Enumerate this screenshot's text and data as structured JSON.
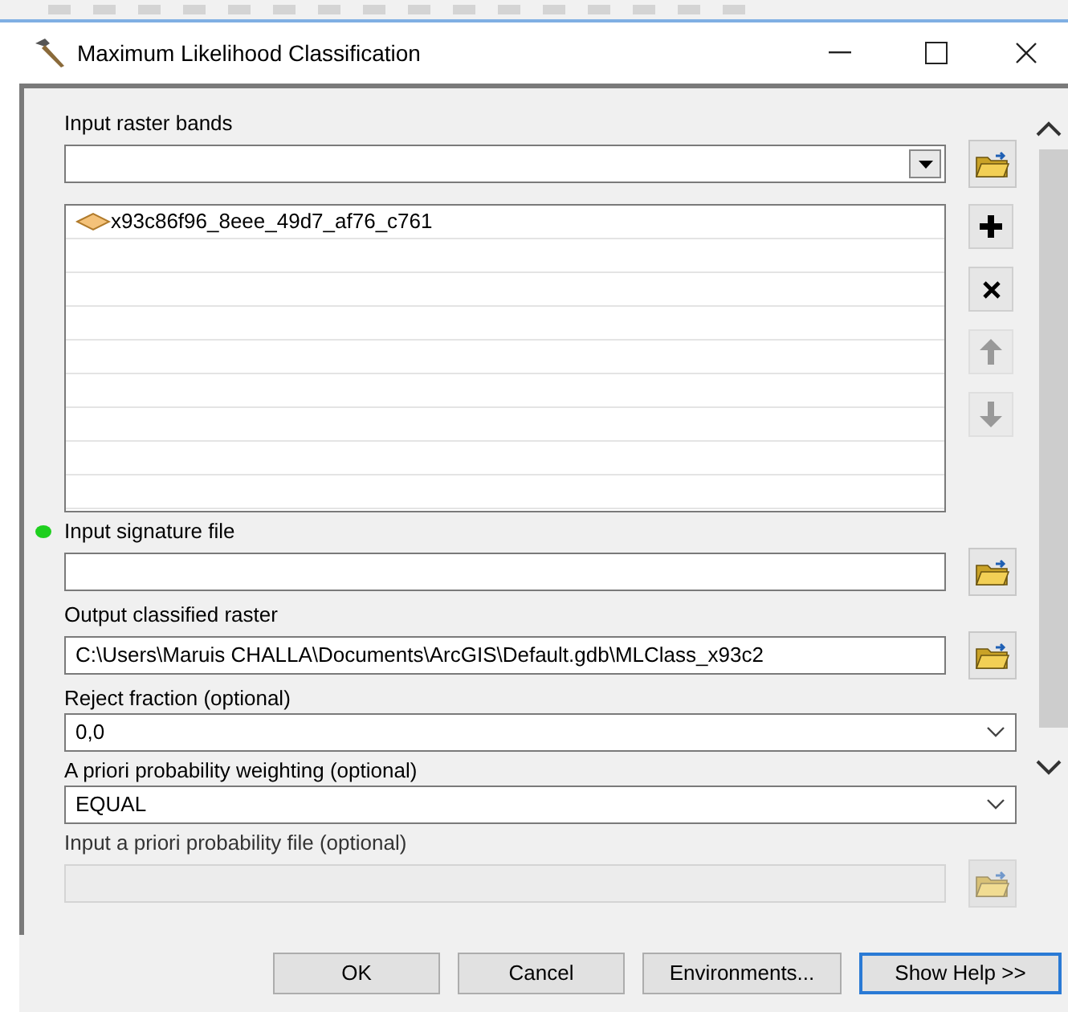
{
  "window": {
    "title": "Maximum Likelihood Classification"
  },
  "input_raster_bands": {
    "label": "Input raster bands",
    "items": [
      {
        "name": "x93c86f96_8eee_49d7_af76_c761"
      }
    ]
  },
  "fields": [
    {
      "kind": "file",
      "label": "Input signature file",
      "required": true,
      "disabled": false
    },
    {
      "kind": "file",
      "label": "Output classified raster",
      "required": false,
      "value": "C:\\Users\\Maruis CHALLA\\Documents\\ArcGIS\\Default.gdb\\MLClass_x93c2",
      "disabled": false
    },
    {
      "kind": "select",
      "label": "Reject fraction (optional)",
      "required": false,
      "value": "0,0",
      "disabled": false
    },
    {
      "kind": "select",
      "label": "A priori probability weighting (optional)",
      "required": false,
      "value": "EQUAL",
      "disabled": false
    },
    {
      "kind": "file",
      "label": "Input a priori probability file (optional)",
      "required": false,
      "disabled": true
    }
  ],
  "buttons": [
    {
      "label": "OK",
      "selected": false
    },
    {
      "label": "Cancel",
      "selected": false
    },
    {
      "label": "Environments...",
      "selected": false
    },
    {
      "label": "Show Help >>",
      "selected": true
    }
  ]
}
